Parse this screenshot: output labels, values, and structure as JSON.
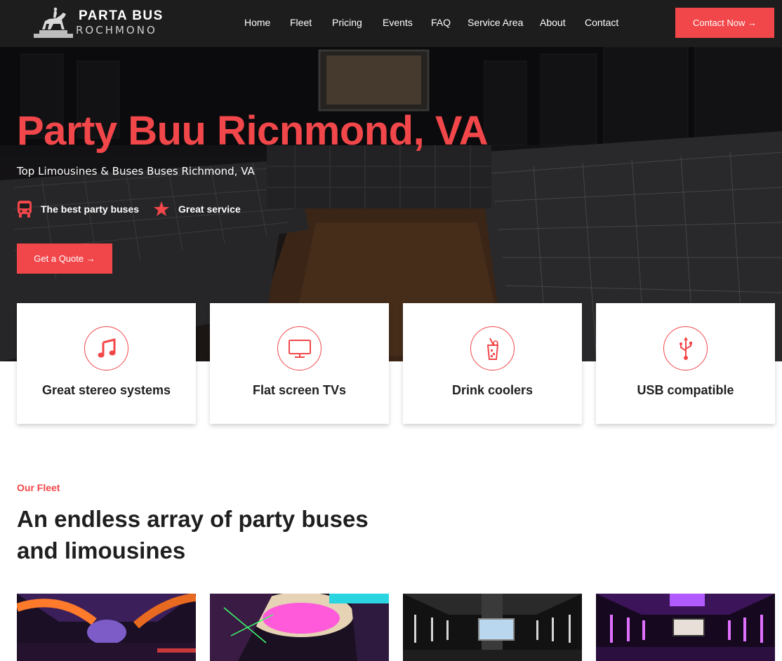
{
  "brand": {
    "name_top": "PARTA BUS",
    "name_bottom": "ROCHMONO"
  },
  "nav": {
    "items": [
      {
        "label": "Home"
      },
      {
        "label": "Fleet"
      },
      {
        "label": "Pricing"
      },
      {
        "label": "Events"
      },
      {
        "label": "FAQ"
      },
      {
        "label": "Service Area"
      },
      {
        "label": "About"
      },
      {
        "label": "Contact"
      }
    ],
    "cta_label": "Contact Now →"
  },
  "hero": {
    "title": "Party Buu Ricnmond, VA",
    "subtitle": "Top Limousines & Buses Buses Richmond, VA",
    "features": [
      {
        "label": "The best party buses",
        "icon": "bus-icon"
      },
      {
        "label": "Great service",
        "icon": "star-icon"
      }
    ],
    "quote_label": "Get a Quote →"
  },
  "amenities": [
    {
      "label": "Great stereo systems",
      "icon": "music-note-icon"
    },
    {
      "label": "Flat screen TVs",
      "icon": "monitor-icon"
    },
    {
      "label": "Drink coolers",
      "icon": "drink-glass-icon"
    },
    {
      "label": "USB compatible",
      "icon": "usb-icon"
    }
  ],
  "fleet": {
    "kicker": "Our Fleet",
    "title": "An endless array of party buses and limousines"
  },
  "colors": {
    "accent": "#f2474a",
    "nav_bg": "#1d1d1d",
    "text_dark": "#1f1f1f"
  }
}
